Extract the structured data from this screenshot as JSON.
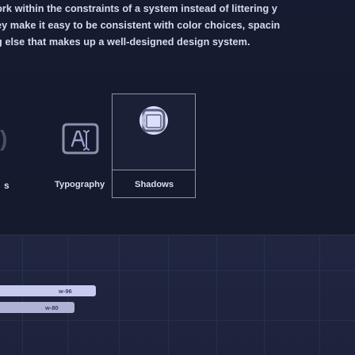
{
  "intro": {
    "lines": [
      "vork within the constraints of a system instead of littering y",
      "ey make it easy to be consistent with color choices, spacin",
      "g else that makes up a well-designed design system."
    ]
  },
  "icon_tiles": {
    "left_stub": ")",
    "typography": {
      "label": "Typography",
      "icon": "typography-icon"
    },
    "shadows": {
      "label": "Shadows",
      "icon": "shadows-icon"
    },
    "label_stub": "s"
  },
  "preview_panel": {
    "bar_labels": [
      "w-96",
      "w-80"
    ],
    "colors": {
      "bar": "#c8cbf0",
      "panel": "#1f243d",
      "border": "#8f93a6"
    }
  },
  "colors": {
    "background": "#161a2f",
    "text": "#d7dbef",
    "muted": "#4c5066"
  }
}
